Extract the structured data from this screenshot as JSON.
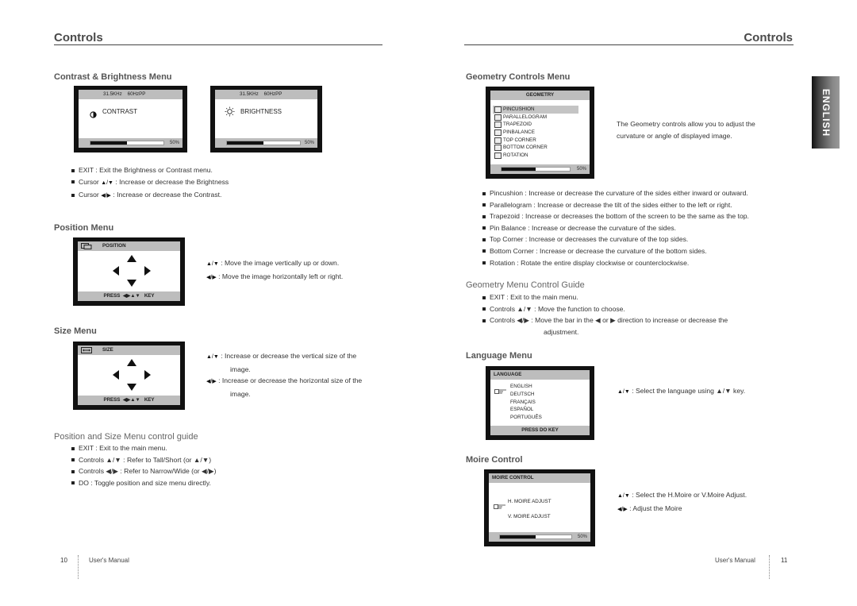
{
  "left_page": {
    "header_title": "Controls",
    "contrast_brightness": {
      "title": "Contrast & Brightness Menu",
      "contrast_osd": {
        "freq": "31.5KHz",
        "hz": "60Hz",
        "mode": "PP",
        "label": "CONTRAST",
        "icon": "contrast-icon",
        "value_percent": 50,
        "value_label": "50%"
      },
      "brightness_osd": {
        "freq": "31.5KHz",
        "hz": "60Hz",
        "mode": "PP",
        "label": "BRIGHTNESS",
        "icon": "sun-icon",
        "value_percent": 50,
        "value_label": "50%"
      },
      "bullets": [
        {
          "text": "EXIT : Exit the Brightness or Contrast menu."
        },
        {
          "prefix": "Cursor ",
          "keys": "▲/▼",
          "text": " : Increase or decrease the Brightness"
        },
        {
          "prefix": "Cursor ",
          "keys": "◀/▶",
          "text": " : Increase or decrease the Contrast."
        }
      ]
    },
    "position": {
      "title": "Position Menu",
      "osd": {
        "header": "POSITION",
        "footer_press": "PRESS",
        "footer_keys": "◀▶▲▼",
        "footer_key": "KEY"
      },
      "desc": [
        {
          "keys": "▲/▼",
          "text": " : Move the image vertically up or down."
        },
        {
          "keys": "◀/▶",
          "text": " : Move the image horizontally left or right."
        }
      ]
    },
    "size": {
      "title": "Size Menu",
      "osd": {
        "header": "SIZE",
        "footer_press": "PRESS",
        "footer_keys": "◀▶▲▼",
        "footer_key": "KEY"
      },
      "desc": [
        {
          "keys": "▲/▼",
          "text": " : Increase or decrease the vertical size of the",
          "cont": "image."
        },
        {
          "keys": "◀/▶",
          "text": " : Increase or decrease the horizontal size of the",
          "cont": "image."
        }
      ]
    },
    "guide": {
      "title": "Position and Size Menu control guide",
      "bullets": [
        {
          "text": "EXIT : Exit to the main menu."
        },
        {
          "text": "Controls ▲/▼ : Refer to Tall/Short (or ▲/▼)"
        },
        {
          "text": "Controls ◀/▶ : Refer to Narrow/Wide (or ◀/▶)"
        },
        {
          "text": "DO : Toggle position and size menu directly."
        }
      ]
    },
    "footer": {
      "page_number": "10",
      "label": "User's Manual"
    }
  },
  "right_page": {
    "header_title": "Controls",
    "language_tab": "ENGLISH",
    "geometry": {
      "title": "Geometry Controls Menu",
      "osd": {
        "header": "GEOMETRY",
        "items": [
          "PINCUSHION",
          "PARALLELOGRAM",
          "TRAPEZOID",
          "PINBALANCE",
          "TOP CORNER",
          "BOTTOM CORNER",
          "ROTATION"
        ],
        "selected": "PINCUSHION",
        "value_percent": 50,
        "value_label": "50%"
      },
      "intro": [
        "The Geometry controls allow you to adjust the",
        "curvature or angle of displayed image."
      ],
      "bullets": [
        {
          "text": "Pincushion : Increase or decrease the curvature of the sides either inward or outward."
        },
        {
          "text": "Parallelogram : Increase or decrease the tilt of the sides either to the left or right."
        },
        {
          "text": "Trapezoid : Increase or decreases the bottom of the screen to be the same as the top."
        },
        {
          "text": "Pin Balance : Increase or decrease the curvature of the sides."
        },
        {
          "text": "Top Corner : Increase or decreases the curvature of the top sides."
        },
        {
          "text": "Bottom Corner : Increase or decrease the curvature of the bottom sides."
        },
        {
          "text": "Rotation : Rotate the entire display clockwise or counterclockwise."
        }
      ]
    },
    "geometry_guide": {
      "title": "Geometry Menu Control Guide",
      "bullets": [
        {
          "text": "EXIT : Exit to the main menu."
        },
        {
          "text": "Controls ▲/▼ : Move the function to choose."
        },
        {
          "text": "Controls ◀/▶ : Move the bar in the ◀ or ▶ direction to increase or decrease the"
        }
      ],
      "continuation": "adjustment."
    },
    "language": {
      "title": "Language Menu",
      "osd": {
        "header": "LANGUAGE",
        "items": [
          "ENGLISH",
          "DEUTSCH",
          "FRANÇAIS",
          "ESPAÑOL",
          "PORTUGUÊS"
        ],
        "selected": "ENGLISH",
        "footer": "PRESS DO KEY"
      },
      "desc": [
        {
          "keys": "▲/▼",
          "text": " : Select the language using ▲/▼ key."
        }
      ]
    },
    "moire": {
      "title": "Moire Control",
      "osd": {
        "header": "MOIRE CONTROL",
        "items": [
          "H. MOIRE ADJUST",
          "V. MOIRE ADJUST"
        ],
        "selected": "H. MOIRE ADJUST",
        "value_percent": 50,
        "value_label": "50%"
      },
      "desc": [
        {
          "keys": "▲/▼",
          "text": " : Select the H.Moire or V.Moire Adjust."
        },
        {
          "keys": "◀/▶",
          "text": " : Adjust the Moire"
        }
      ]
    },
    "footer": {
      "page_number": "11",
      "label": "User's Manual"
    }
  }
}
